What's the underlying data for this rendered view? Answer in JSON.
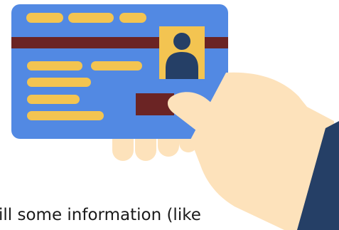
{
  "caption": {
    "text": "ill some information (like"
  },
  "colors": {
    "card": "#5289e3",
    "card_stripe": "#6b2424",
    "text_bars": "#f3c451",
    "photo_frame": "#f3c451",
    "person": "#253f66",
    "skin": "#fde2bb",
    "sleeve": "#253f66"
  },
  "icons": [
    "id-card-icon",
    "hand-icon",
    "sleeve-icon",
    "portrait-icon"
  ]
}
